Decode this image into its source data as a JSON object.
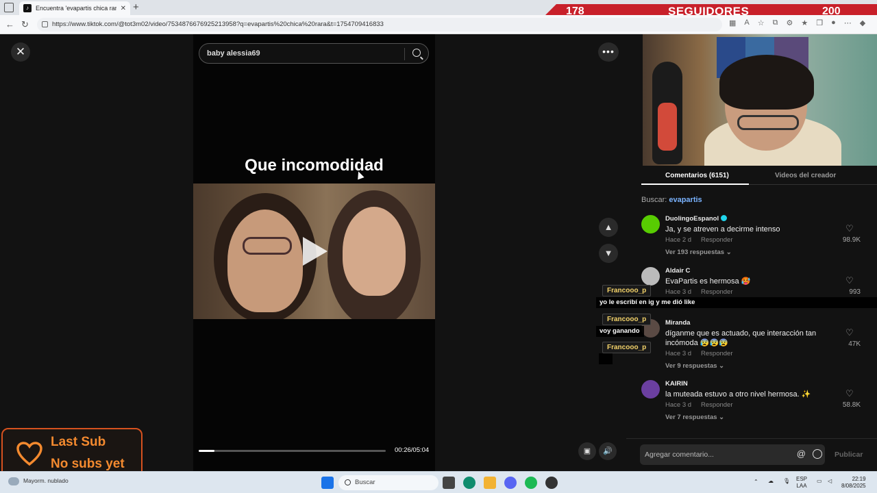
{
  "browser": {
    "tab_title": "Encuentra 'evapartis chica rara' en",
    "url": "https://www.tiktok.com/@tot3m02/video/7534876676925213958?q=evapartis%20chica%20rara&t=1754709416833"
  },
  "followers_banner": {
    "current": "178",
    "label": "SEGUIDORES",
    "goal": "200"
  },
  "video": {
    "search_query": "baby alessia69",
    "overlay_text": "Que incomodidad",
    "time": "00:26/05:04",
    "progress": 0.084
  },
  "comments_panel": {
    "tabs": [
      "Comentarios (6151)",
      "Videos del creador"
    ],
    "search_label": "Buscar:",
    "search_term": "evapartis",
    "comments": [
      {
        "user": "DuolingoEspanol",
        "text": "Ja, y se atreven a decirme intenso",
        "time": "Hace 2 d",
        "reply": "Responder",
        "replies": "Ver 193 respuestas",
        "likes": "98.9K",
        "avatar_color": "#58cc02"
      },
      {
        "user": "Aldair C",
        "text": "EvaPartis es hermosa 🥵",
        "time": "Hace 3 d",
        "reply": "Responder",
        "replies": "",
        "likes": "993",
        "avatar_color": "#bbbbbb"
      },
      {
        "user": "Miranda",
        "text": "díganme que es actuado, que interacción tan incómoda 😰😰😰",
        "time": "Hace 3 d",
        "reply": "Responder",
        "replies": "Ver 9 respuestas",
        "likes": "47K",
        "avatar_color": "#5a4a44"
      },
      {
        "user": "KAIRIN",
        "text": "la muteada estuvo a otro nivel hermosa. ✨",
        "time": "Hace 3 d",
        "reply": "Responder",
        "replies": "Ver 7 respuestas",
        "likes": "58.8K",
        "avatar_color": "#6b3fa0"
      }
    ],
    "add_comment_placeholder": "Agregar comentario...",
    "publish_label": "Publicar"
  },
  "chat_overlay": [
    {
      "name": "Francooo_p",
      "message": "yo le escribí en ig y me dió like"
    },
    {
      "name": "Francooo_p",
      "message": "voy ganando"
    },
    {
      "name": "Francooo_p",
      "message": ""
    }
  ],
  "last_sub": {
    "line1": "Last Sub",
    "line2": "No subs yet"
  },
  "taskbar": {
    "weather": "Mayorm. nublado",
    "search": "Buscar",
    "lang_top": "ESP",
    "lang_bottom": "LAA",
    "time": "22:19",
    "date": "8/08/2025"
  }
}
